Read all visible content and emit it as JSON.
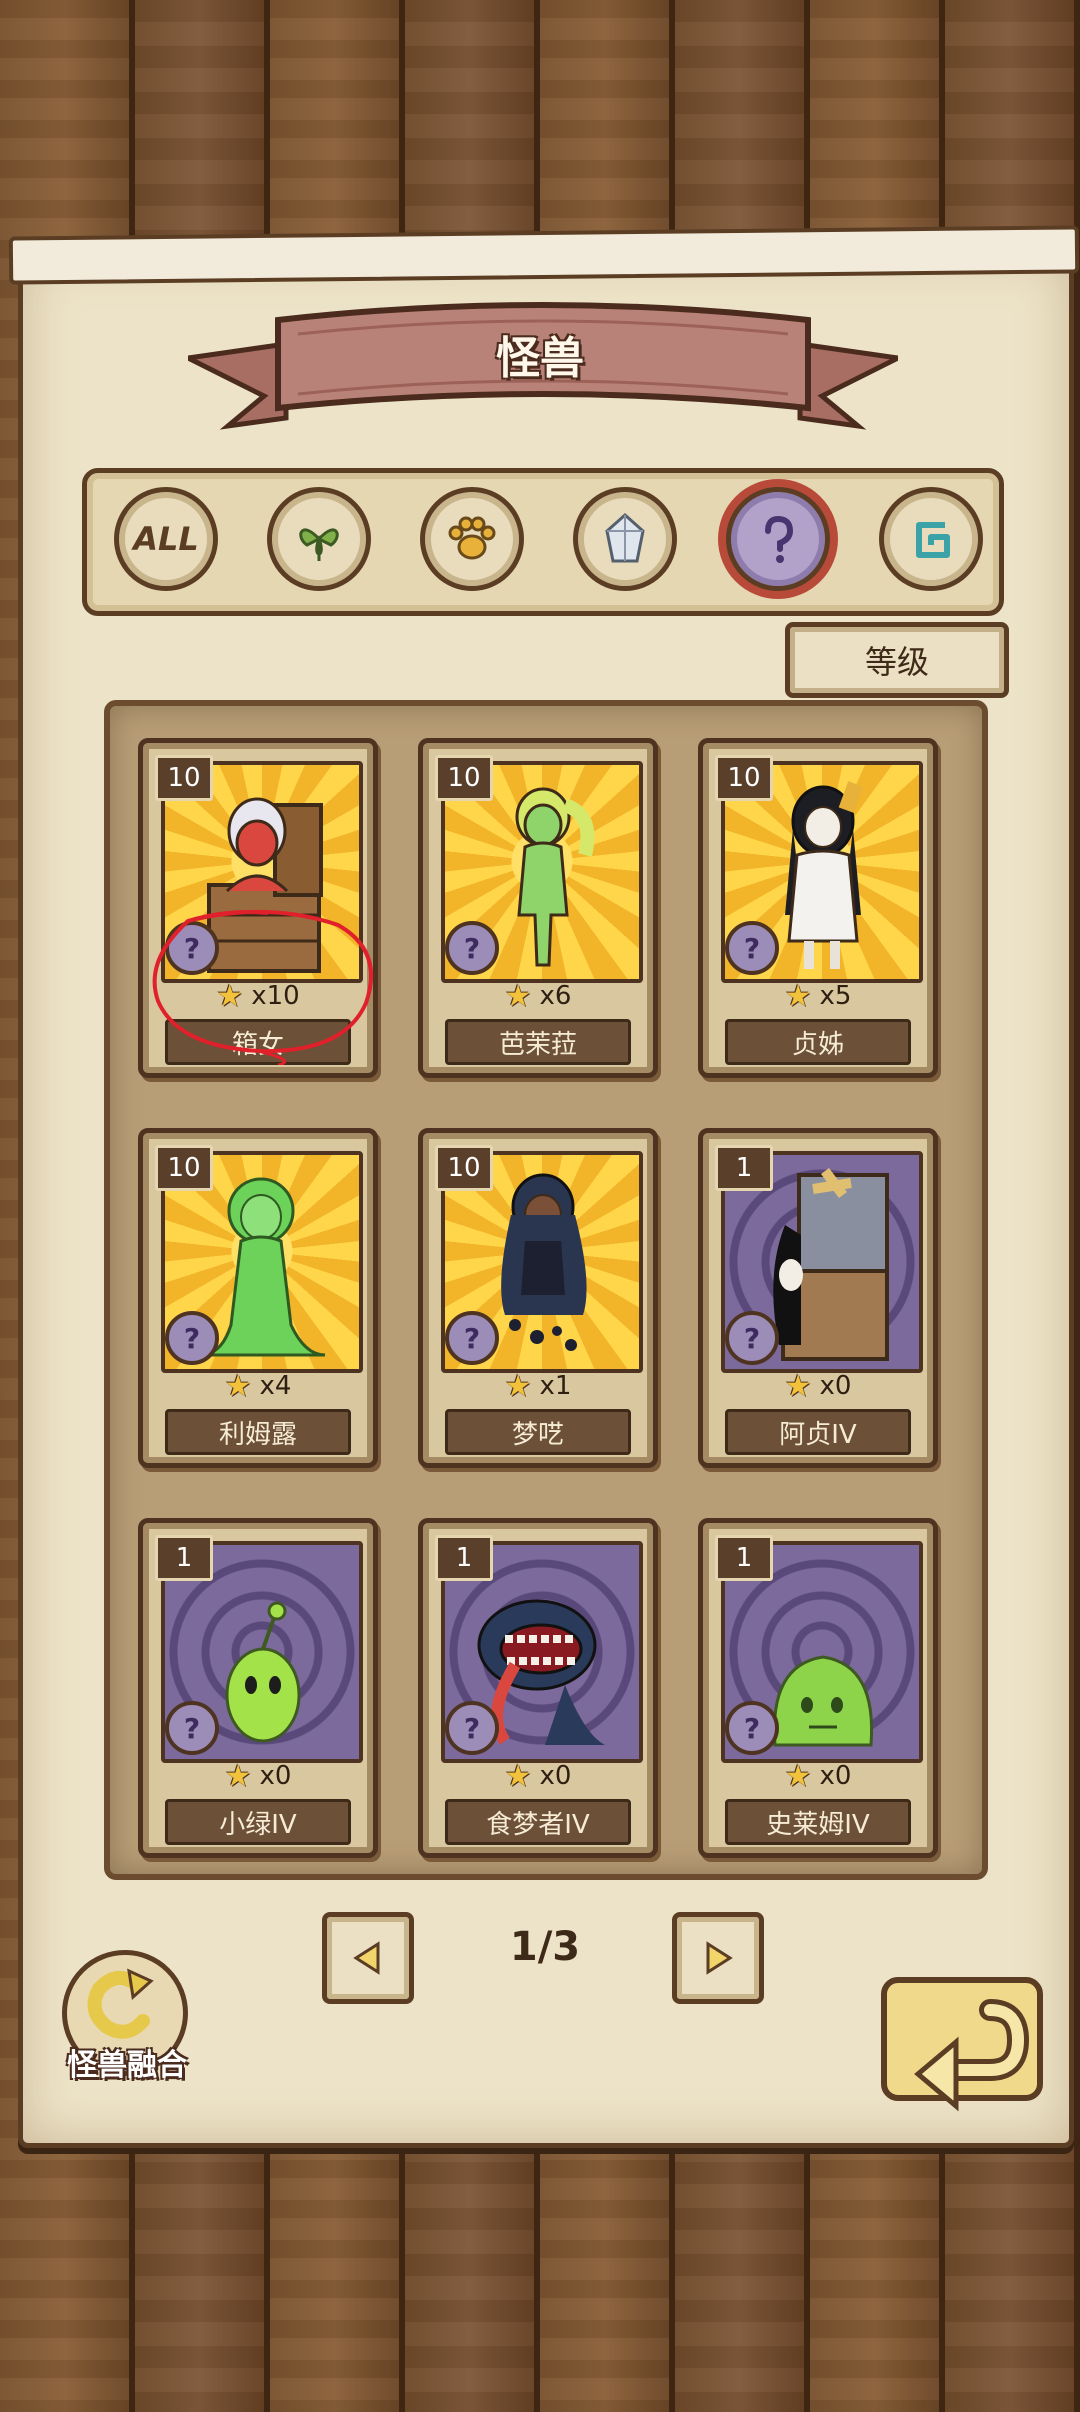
{
  "header": {
    "title": "怪兽"
  },
  "filters": [
    {
      "id": "all",
      "label": "ALL",
      "icon": "all-icon",
      "active": false
    },
    {
      "id": "plant",
      "label": "",
      "icon": "leaf-icon",
      "active": false
    },
    {
      "id": "beast",
      "label": "",
      "icon": "paw-icon",
      "active": false
    },
    {
      "id": "mineral",
      "label": "",
      "icon": "crystal-icon",
      "active": false
    },
    {
      "id": "unknown",
      "label": "",
      "icon": "question-icon",
      "active": true
    },
    {
      "id": "other",
      "label": "",
      "icon": "swirl-icon",
      "active": false
    }
  ],
  "sort": {
    "label": "等级"
  },
  "cards": [
    {
      "name": "箱女",
      "level": "10",
      "stars": "x10",
      "bg": "gold",
      "kind": "chest"
    },
    {
      "name": "芭茉菈",
      "level": "10",
      "stars": "x6",
      "bg": "gold",
      "kind": "greengirl"
    },
    {
      "name": "贞姊",
      "level": "10",
      "stars": "x5",
      "bg": "gold",
      "kind": "ghost"
    },
    {
      "name": "利姆露",
      "level": "10",
      "stars": "x4",
      "bg": "gold",
      "kind": "slimegirl"
    },
    {
      "name": "梦呓",
      "level": "10",
      "stars": "x1",
      "bg": "gold",
      "kind": "shadowgirl"
    },
    {
      "name": "阿贞IV",
      "level": "1",
      "stars": "x0",
      "bg": "purple",
      "kind": "box"
    },
    {
      "name": "小绿IV",
      "level": "1",
      "stars": "x0",
      "bg": "purple",
      "kind": "alien"
    },
    {
      "name": "食梦者IV",
      "level": "1",
      "stars": "x0",
      "bg": "purple",
      "kind": "mouth"
    },
    {
      "name": "史莱姆IV",
      "level": "1",
      "stars": "x0",
      "bg": "purple",
      "kind": "slime"
    }
  ],
  "pagination": {
    "indicator": "1/3",
    "prev_icon": "triangle-left-icon",
    "next_icon": "triangle-right-icon"
  },
  "fusion": {
    "label": "怪兽融合",
    "icon": "fusion-icon"
  },
  "back": {
    "icon": "return-arrow-icon"
  },
  "colors": {
    "paper": "#ede3c8",
    "ribbon": "#b98278",
    "active_ring": "#b84a3a",
    "annotation": "#e0202a"
  }
}
